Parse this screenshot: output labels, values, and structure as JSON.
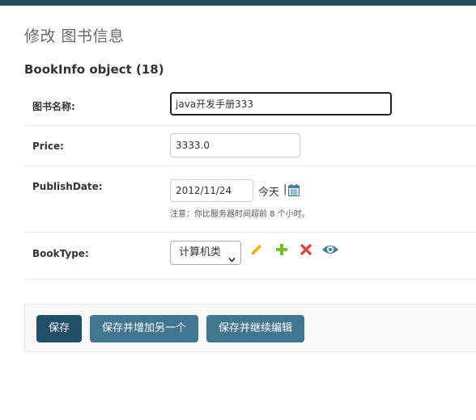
{
  "page": {
    "title": "修改 图书信息",
    "object_title": "BookInfo object (18)"
  },
  "fields": {
    "name": {
      "label": "图书名称:",
      "value": "java开发手册333"
    },
    "price": {
      "label": "Price:",
      "value": "3333.0"
    },
    "publish_date": {
      "label": "PublishDate:",
      "value": "2012/11/24",
      "today_link": "今天",
      "separator": "|",
      "calendar_icon": "calendar-icon",
      "help_text": "注意：你比服务器时间超前 8 个小时。"
    },
    "book_type": {
      "label": "BookType:",
      "selected": "计算机类",
      "actions": [
        "pencil-icon",
        "plus-icon",
        "close-icon",
        "eye-icon"
      ]
    }
  },
  "buttons": {
    "save": "保存",
    "save_add_another": "保存并增加另一个",
    "save_continue": "保存并继续编辑"
  },
  "colors": {
    "header": "#264b5d",
    "primary_button": "#205067",
    "button": "#417690",
    "edit_icon": "#efb80b",
    "add_icon": "#70bf2b",
    "delete_icon": "#dd4646",
    "view_icon": "#447e9b"
  }
}
